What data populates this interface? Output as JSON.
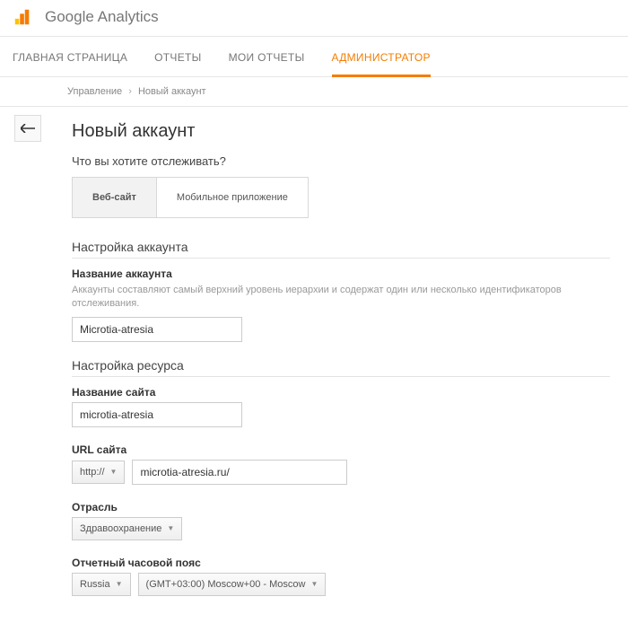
{
  "app_title": "Google Analytics",
  "tabs": {
    "home": "ГЛАВНАЯ СТРАНИЦА",
    "reports": "ОТЧЕТЫ",
    "my_reports": "МОИ ОТЧЕТЫ",
    "admin": "АДМИНИСТРАТОР"
  },
  "breadcrumb": {
    "root": "Управление",
    "current": "Новый аккаунт"
  },
  "page_title": "Новый аккаунт",
  "track_question": "Что вы хотите отслеживать?",
  "track_options": {
    "website": "Веб-сайт",
    "mobile": "Мобильное приложение"
  },
  "account_setup": {
    "title": "Настройка аккаунта",
    "name_label": "Название аккаунта",
    "name_help": "Аккаунты составляют самый верхний уровень иерархии и содержат один или несколько идентификаторов отслеживания.",
    "name_value": "Microtia-atresia"
  },
  "property_setup": {
    "title": "Настройка ресурса",
    "site_name_label": "Название сайта",
    "site_name_value": "microtia-atresia",
    "url_label": "URL сайта",
    "url_scheme": "http://",
    "url_value": "microtia-atresia.ru/",
    "industry_label": "Отрасль",
    "industry_value": "Здравоохранение",
    "timezone_label": "Отчетный часовой пояс",
    "timezone_country": "Russia",
    "timezone_value": "(GMT+03:00) Moscow+00 - Moscow"
  }
}
